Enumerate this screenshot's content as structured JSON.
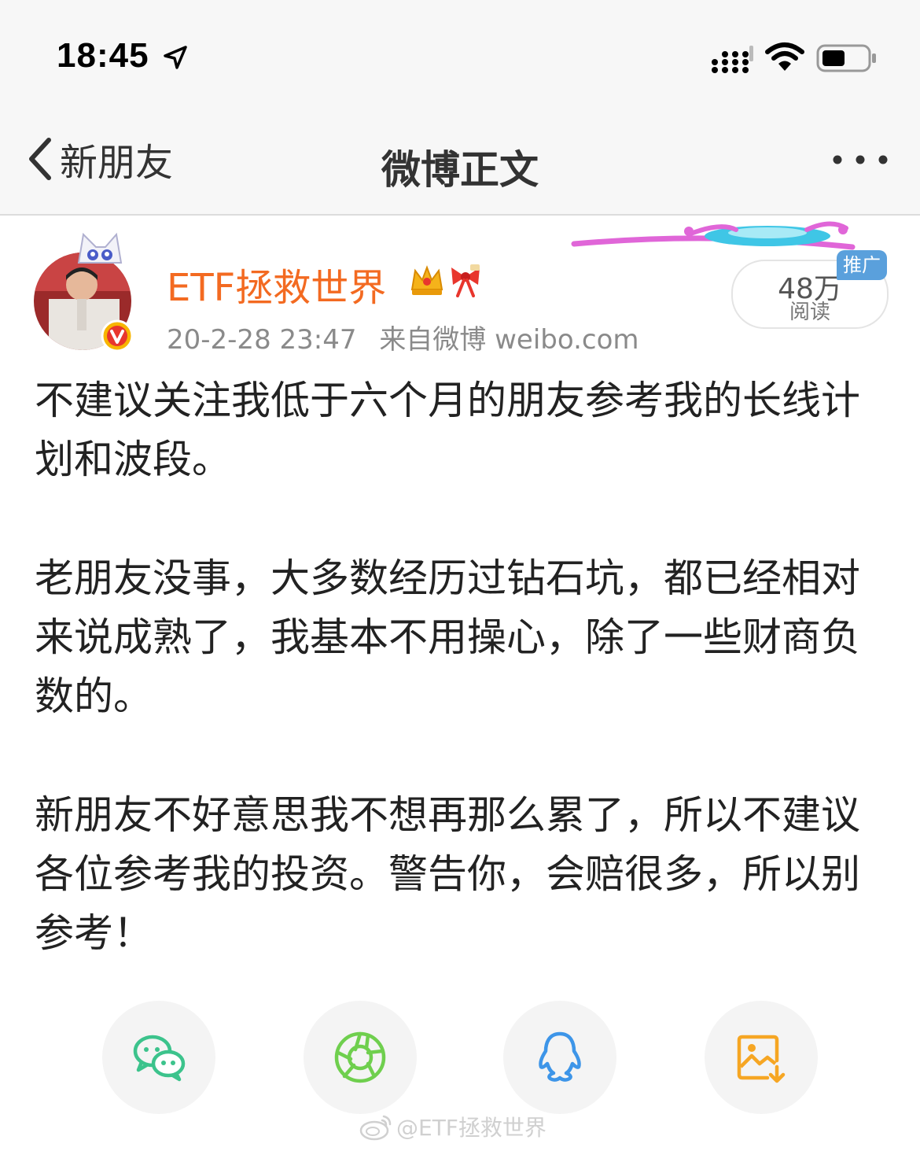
{
  "status_bar": {
    "time": "18:45",
    "icons": [
      "location-arrow-icon",
      "cellular-signal-icon",
      "wifi-icon",
      "battery-icon"
    ]
  },
  "nav": {
    "back_label": "新朋友",
    "title": "微博正文",
    "more_icon": "more-dots-icon"
  },
  "post": {
    "username": "ETF拯救世界",
    "badges": [
      "crown-icon",
      "ribbon-icon",
      "verified-v-icon"
    ],
    "timestamp": "20-2-28 23:47",
    "source": "来自微博 weibo.com",
    "reads_count": "48万",
    "reads_label": "阅读",
    "promo_label": "推广",
    "paragraphs": [
      "不建议关注我低于六个月的朋友参考我的长线计划和波段。",
      "老朋友没事，大多数经历过钻石坑，都已经相对来说成熟了，我基本不用操心，除了一些财商负数的。",
      "新朋友不好意思我不想再那么累了，所以不建议各位参考我的投资。警告你，会赔很多，所以别参考！"
    ]
  },
  "share": {
    "buttons": [
      "wechat-icon",
      "moments-icon",
      "qq-icon",
      "save-image-icon"
    ]
  },
  "watermark": {
    "text": "@ETF拯救世界"
  },
  "colors": {
    "username": "#f36a21",
    "wechat": "#3cc38c",
    "moments": "#6fcf4e",
    "qq": "#3d95e8",
    "save": "#f6a623",
    "promo": "#5aa0dc"
  }
}
